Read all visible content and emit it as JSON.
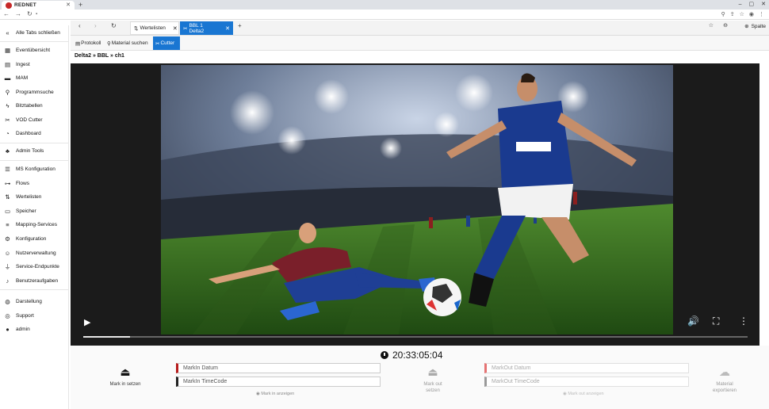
{
  "browser": {
    "brand": "REDNET",
    "new_tab": "+",
    "window_controls": [
      "–",
      "▢",
      "✕"
    ]
  },
  "sidebar": {
    "items": [
      {
        "label": "Alle Tabs schließen",
        "icon": "double-chevron-left-icon"
      },
      {
        "label": "Eventübersicht",
        "icon": "calendar-icon"
      },
      {
        "label": "Ingest",
        "icon": "file-icon"
      },
      {
        "label": "MAM",
        "icon": "folder-icon"
      },
      {
        "label": "Programmsuche",
        "icon": "search-icon"
      },
      {
        "label": "Bitztabellen",
        "icon": "bolt-icon"
      },
      {
        "label": "VOD Cutter",
        "icon": "scissors-icon"
      },
      {
        "label": "Dashboard",
        "icon": "dashboard-icon"
      },
      {
        "label": "Admin Tools",
        "icon": "user-cog-icon"
      },
      {
        "label": "MS Konfiguration",
        "icon": "list-icon"
      },
      {
        "label": "Flows",
        "icon": "flow-icon"
      },
      {
        "label": "Wertelisten",
        "icon": "sort-icon"
      },
      {
        "label": "Speicher",
        "icon": "storage-icon"
      },
      {
        "label": "Mapping-Services",
        "icon": "mapping-icon"
      },
      {
        "label": "Konfiguration",
        "icon": "cogs-icon"
      },
      {
        "label": "Nutzerverwaltung",
        "icon": "users-icon"
      },
      {
        "label": "Service-Endpunkte",
        "icon": "plug-icon"
      },
      {
        "label": "Benutzeraufgaben",
        "icon": "bell-icon"
      },
      {
        "label": "Darstellung",
        "icon": "palette-icon"
      },
      {
        "label": "Support",
        "icon": "globe-icon"
      },
      {
        "label": "admin",
        "icon": "user-icon"
      }
    ]
  },
  "apptabs": {
    "tabs": [
      {
        "label": "Wertelisten",
        "active": false
      },
      {
        "label": "BBL 1 Delta2",
        "active": true
      }
    ],
    "add": "+",
    "column_button": "Spalte"
  },
  "subtoolbar": {
    "items": [
      {
        "label": "Protokoll",
        "active": false
      },
      {
        "label": "Material suchen",
        "active": false
      },
      {
        "label": "Cutter",
        "active": true
      }
    ]
  },
  "breadcrumb": "Delta2 » BBL » ch1",
  "player": {
    "progress": 0.07
  },
  "timecode": "20:33:05:04",
  "markin": {
    "button": "Mark in setzen",
    "date_placeholder": "MarkIn Datum",
    "tc_placeholder": "MarkIn TimeCode",
    "show_link": "Mark in anzeigen"
  },
  "markout": {
    "button": "Mark out setzen",
    "date_placeholder": "MarkOut Datum",
    "tc_placeholder": "MarkOut TimeCode",
    "show_link": "Mark out anzeigen"
  },
  "export": {
    "button": "Material exportieren"
  }
}
